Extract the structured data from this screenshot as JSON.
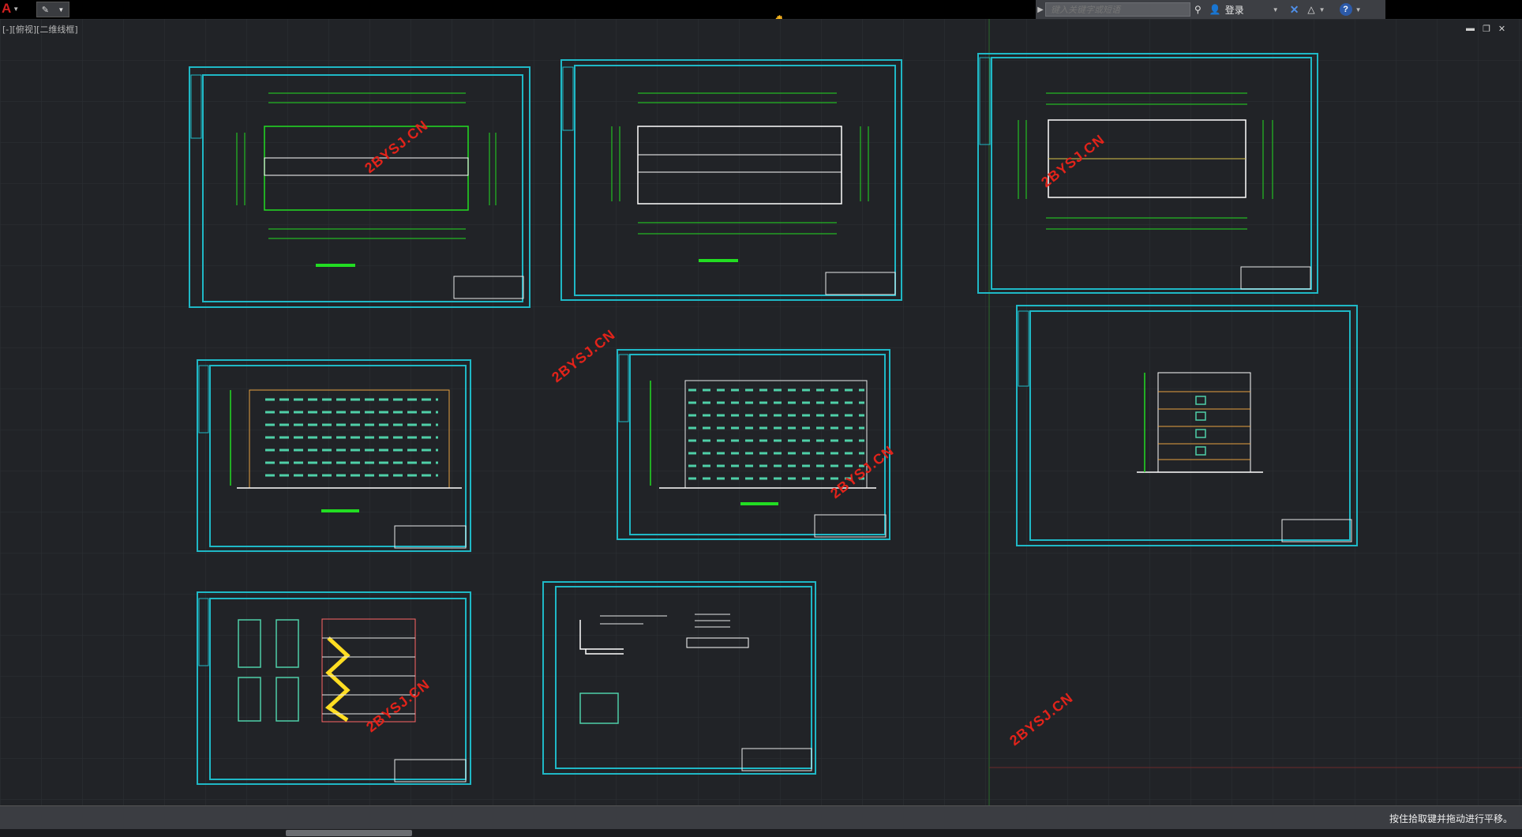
{
  "toolbar": {
    "app_icon": "autocad-logo-icon",
    "search_placeholder": "键入关键字或短语",
    "login_label": "登录"
  },
  "view": {
    "label": "[-][俯视][二维线框]"
  },
  "watermark": "2BYSJ.CN",
  "status": {
    "message": "按住拾取键并拖动进行平移。"
  },
  "colors": {
    "background": "#212327",
    "frame": "#1fb8c6",
    "drawing_green": "#22dd22",
    "watermark_red": "#e2231a",
    "grid": "#2d3036"
  }
}
